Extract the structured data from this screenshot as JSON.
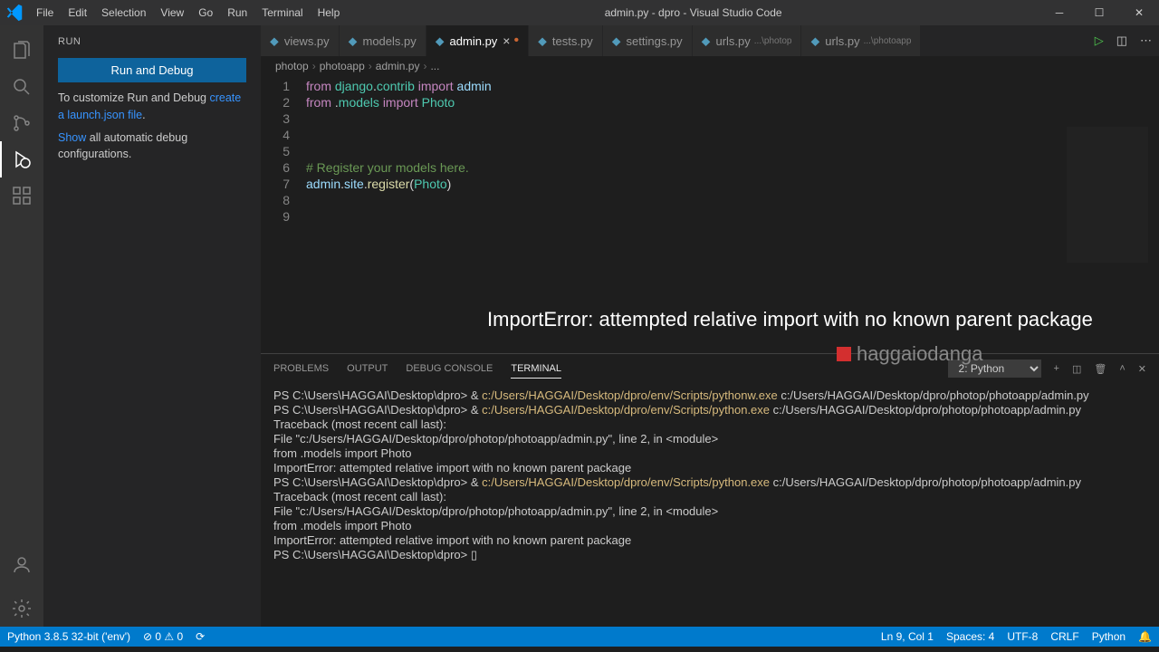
{
  "titlebar": {
    "title": "admin.py - dpro - Visual Studio Code",
    "menu": [
      "File",
      "Edit",
      "Selection",
      "View",
      "Go",
      "Run",
      "Terminal",
      "Help"
    ]
  },
  "sidebar": {
    "header": "RUN",
    "run_btn": "Run and Debug",
    "custom1": "To customize Run and Debug ",
    "custom_link": "create a launch.json file",
    "custom2": ".",
    "show": "Show",
    "show2": " all automatic debug configurations."
  },
  "tabs": {
    "items": [
      {
        "label": "views.py",
        "active": false
      },
      {
        "label": "models.py",
        "active": false
      },
      {
        "label": "admin.py",
        "active": true,
        "mod": true
      },
      {
        "label": "tests.py",
        "active": false
      },
      {
        "label": "settings.py",
        "active": false
      },
      {
        "label": "urls.py",
        "sub": "...\\photop",
        "active": false
      },
      {
        "label": "urls.py",
        "sub": "...\\photoapp",
        "active": false
      }
    ]
  },
  "breadcrumb": [
    "photop",
    "photoapp",
    "admin.py",
    "..."
  ],
  "code": {
    "lines": [
      {
        "n": 1,
        "html": "<span class='kw'>from</span> <span class='cls'>django</span>.<span class='cls'>contrib</span> <span class='kw'>import</span> <span class='var'>admin</span>"
      },
      {
        "n": 2,
        "html": "<span class='kw'>from</span> .<span class='cls'>models</span> <span class='kw'>import</span> <span class='cls'>Photo</span>"
      },
      {
        "n": 3,
        "html": ""
      },
      {
        "n": 4,
        "html": ""
      },
      {
        "n": 5,
        "html": ""
      },
      {
        "n": 6,
        "html": "<span class='com'># Register your models here.</span>"
      },
      {
        "n": 7,
        "html": "<span class='var'>admin</span>.<span class='var'>site</span>.<span class='fn'>register</span>(<span class='cls'>Photo</span>)"
      },
      {
        "n": 8,
        "html": ""
      },
      {
        "n": 9,
        "html": ""
      }
    ]
  },
  "overlay": {
    "title": "ImportError: attempted relative import with no known parent package",
    "author": "haggaiodanga"
  },
  "panel": {
    "tabs": [
      "PROBLEMS",
      "OUTPUT",
      "DEBUG CONSOLE",
      "TERMINAL"
    ],
    "active": 3,
    "selector": "2: Python",
    "terminal": [
      {
        "raw": "PS C:\\Users\\HAGGAI\\Desktop\\dpro> & <span class='y'>c:/Users/HAGGAI/Desktop/dpro/env/Scripts/pythonw.exe</span> c:/Users/HAGGAI/Desktop/dpro/photop/photoapp/admin.py"
      },
      {
        "raw": "PS C:\\Users\\HAGGAI\\Desktop\\dpro> & <span class='y'>c:/Users/HAGGAI/Desktop/dpro/env/Scripts/python.exe</span> c:/Users/HAGGAI/Desktop/dpro/photop/photoapp/admin.py"
      },
      {
        "raw": "Traceback (most recent call last):"
      },
      {
        "raw": "  File \"c:/Users/HAGGAI/Desktop/dpro/photop/photoapp/admin.py\", line 2, in &lt;module&gt;"
      },
      {
        "raw": "    from .models import Photo"
      },
      {
        "raw": "ImportError: attempted relative import with no known parent package"
      },
      {
        "raw": "PS C:\\Users\\HAGGAI\\Desktop\\dpro> & <span class='y'>c:/Users/HAGGAI/Desktop/dpro/env/Scripts/python.exe</span> c:/Users/HAGGAI/Desktop/dpro/photop/photoapp/admin.py"
      },
      {
        "raw": "Traceback (most recent call last):"
      },
      {
        "raw": "  File \"c:/Users/HAGGAI/Desktop/dpro/photop/photoapp/admin.py\", line 2, in &lt;module&gt;"
      },
      {
        "raw": "    from .models import Photo"
      },
      {
        "raw": "ImportError: attempted relative import with no known parent package"
      },
      {
        "raw": "PS C:\\Users\\HAGGAI\\Desktop\\dpro> ▯"
      }
    ]
  },
  "status": {
    "left": [
      "Python 3.8.5 32-bit ('env')",
      "⊘ 0 ⚠ 0",
      "⟳"
    ],
    "right": [
      "Ln 9, Col 1",
      "Spaces: 4",
      "UTF-8",
      "CRLF",
      "Python",
      "🔔"
    ]
  }
}
